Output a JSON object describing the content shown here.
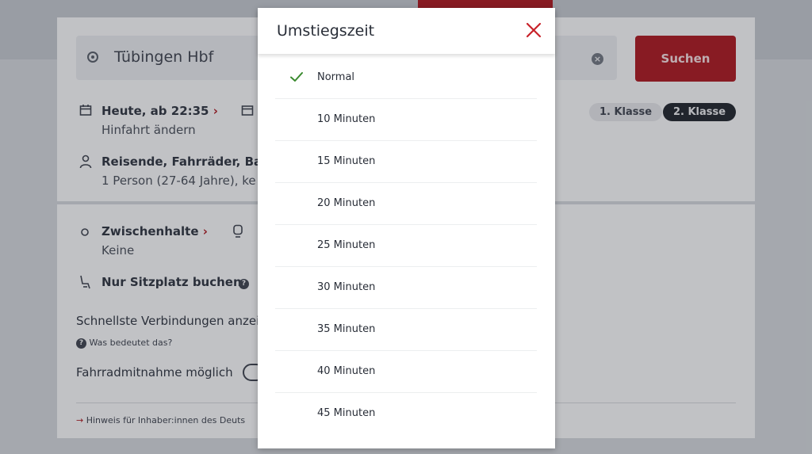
{
  "search": {
    "origin_value": "Tübingen Hbf",
    "submit_label": "Suchen"
  },
  "date": {
    "label": "Heute, ab 22:35",
    "sub_label": "Hinfahrt ändern"
  },
  "class": {
    "first": "1. Klasse",
    "second": "2. Klasse",
    "selected": "2. Klasse"
  },
  "travelers": {
    "label": "Reisende, Fahrräder, Bah",
    "sub_label": "1 Person (27-64 Jahre), ke"
  },
  "stops": {
    "label": "Zwischenhalte",
    "sub_label": "Keine"
  },
  "seat": {
    "label": "Nur Sitzplatz buchen"
  },
  "fastest": {
    "label": "Schnellste Verbindungen anzei",
    "help": "Was bedeutet das?"
  },
  "bike": {
    "label": "Fahrradmitnahme möglich"
  },
  "notice": {
    "text": "Hinweis für Inhaber:innen des Deuts"
  },
  "modal": {
    "title": "Umstiegszeit",
    "selected": "Normal",
    "options": [
      "Normal",
      "10 Minuten",
      "15 Minuten",
      "20 Minuten",
      "25 Minuten",
      "30 Minuten",
      "35 Minuten",
      "40 Minuten",
      "45 Minuten"
    ]
  },
  "colors": {
    "accent_red": "#a8161d",
    "check_green": "#3a8a2e"
  },
  "icons": [
    "calendar-icon",
    "person-icon",
    "circle-icon",
    "seat-icon",
    "help-icon",
    "arrow-right-icon",
    "check-icon",
    "close-icon",
    "clear-icon"
  ]
}
